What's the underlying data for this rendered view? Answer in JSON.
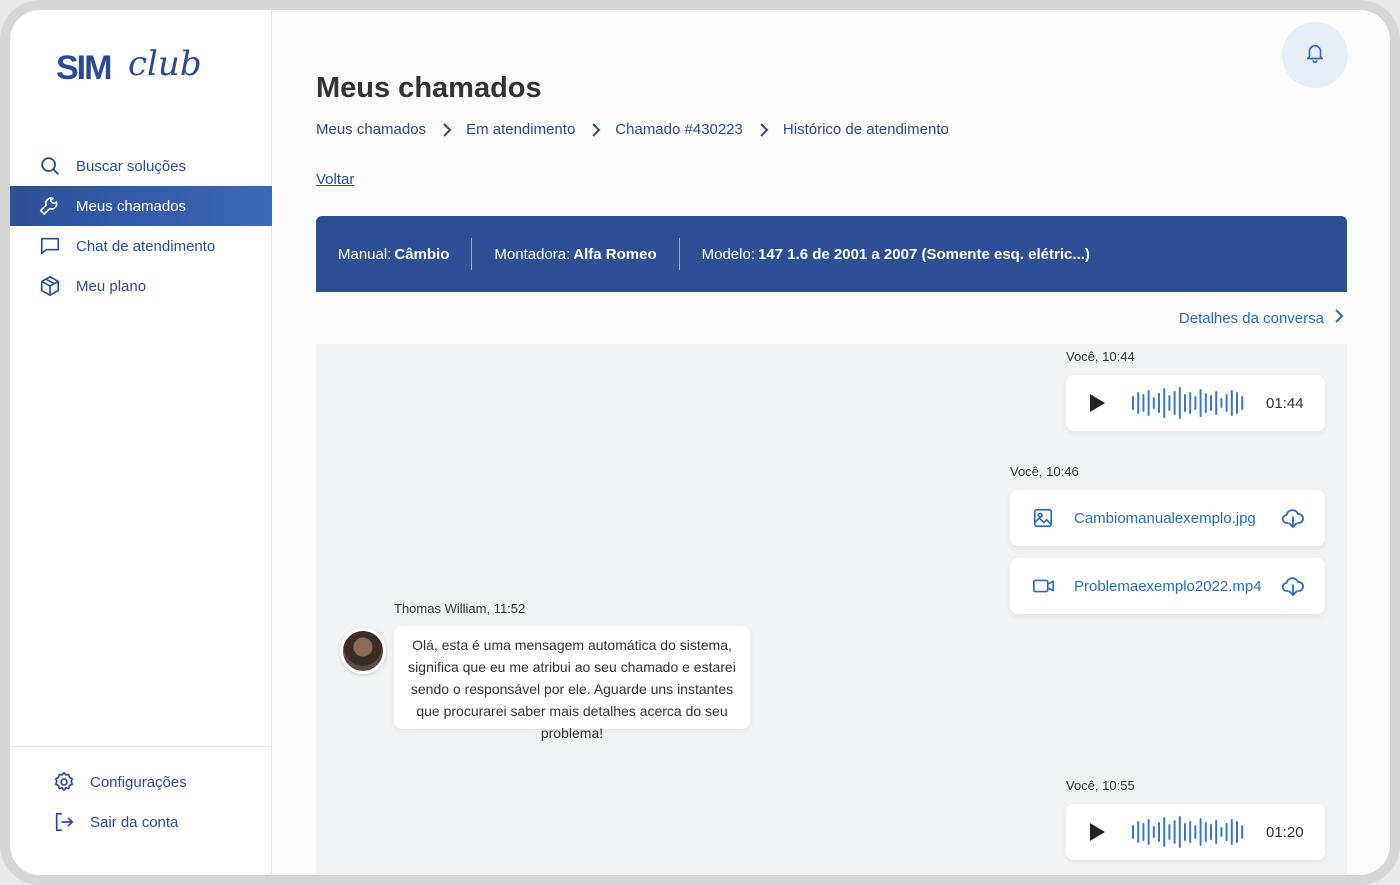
{
  "logo": {
    "sim": "SIM",
    "club": "club"
  },
  "sidebar": {
    "items": [
      {
        "label": "Buscar soluções",
        "icon": "search-icon",
        "active": false
      },
      {
        "label": "Meus chamados",
        "icon": "wrench-icon",
        "active": true
      },
      {
        "label": "Chat de atendimento",
        "icon": "chat-icon",
        "active": false
      },
      {
        "label": "Meu plano",
        "icon": "package-icon",
        "active": false
      }
    ],
    "bottom": [
      {
        "label": "Configurações",
        "icon": "gear-icon"
      },
      {
        "label": "Sair da conta",
        "icon": "logout-icon"
      }
    ]
  },
  "header": {
    "title": "Meus chamados",
    "breadcrumb": [
      "Meus chamados",
      "Em atendimento",
      "Chamado #430223",
      "Histórico de atendimento"
    ],
    "back": "Voltar"
  },
  "info": {
    "manual_label": "Manual:",
    "manual_value": "Câmbio",
    "montadora_label": "Montadora:",
    "montadora_value": "Alfa Romeo",
    "modelo_label": "Modelo:",
    "modelo_value": "147 1.6 de 2001 a 2007 (Somente esq. elétric...)"
  },
  "details_link": "Detalhes da conversa",
  "colors": {
    "primary": "#2d4f94",
    "link": "#2b6cb8",
    "wave": "#3a78c4"
  },
  "messages": {
    "m1": {
      "timestamp": "Você, 10:44",
      "duration": "01:44"
    },
    "m2": {
      "timestamp": "Você, 10:46",
      "files": [
        "Cambiomanualexemplo.jpg",
        "Problemaexemplo2022.mp4"
      ]
    },
    "m3": {
      "timestamp": "Thomas William, 11:52",
      "text": "Olá, esta é uma mensagem automática do sistema, significa que eu me atribui ao seu chamado e estarei sendo o responsável por ele. Aguarde uns instantes que procurarei saber mais detalhes acerca do seu problema!"
    },
    "m4": {
      "timestamp": "Você, 10:55",
      "duration": "01:20"
    }
  }
}
